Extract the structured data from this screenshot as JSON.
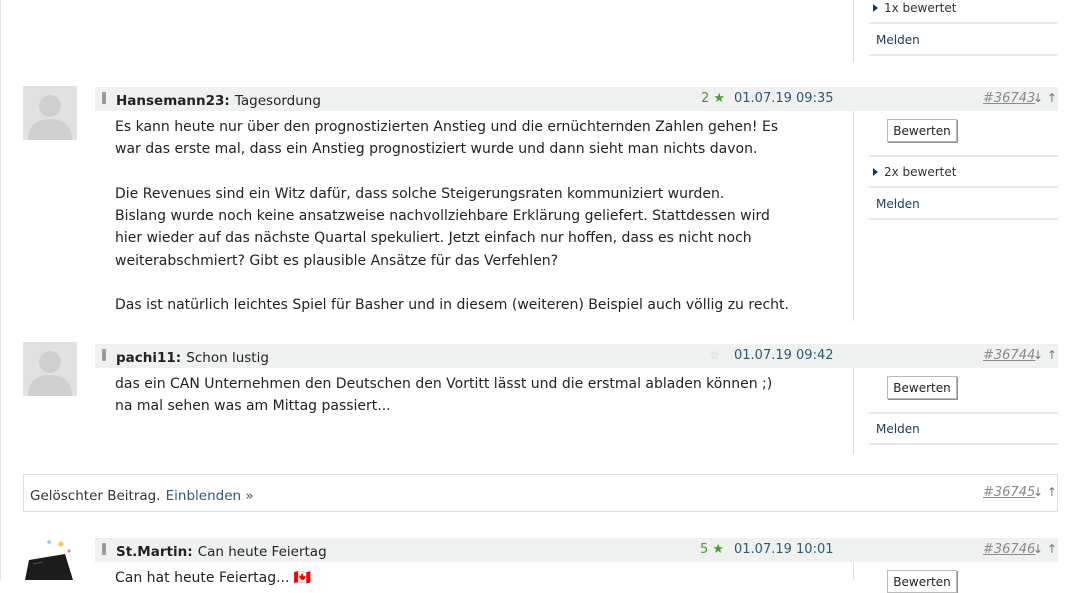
{
  "top_post": {
    "rated_label": "1x bewertet",
    "report_label": "Melden"
  },
  "posts": [
    {
      "author": "Hansemann23:",
      "subject": "Tagesordung",
      "rating_count": "2",
      "rating_star": "★",
      "datetime": "01.07.19 09:35",
      "post_id": "#36743",
      "nav": "↓ ↑",
      "paragraphs": [
        "Es kann heute nur über den prognostizierten Anstieg und die ernüchternden Zahlen gehen! Es war das erste mal, dass ein Anstieg prognostiziert wurde und dann sieht man nichts davon.",
        "Die Revenues sind ein Witz dafür, dass solche Steigerungsraten kommuniziert wurden.\nBislang wurde noch keine ansatzweise nachvollziehbare Erklärung geliefert. Stattdessen wird hier wieder auf das nächste Quartal spekuliert. Jetzt einfach nur hoffen, dass es nicht noch weiterabschmiert? Gibt es plausible Ansätze für das Verfehlen?",
        "Das ist natürlich leichtes Spiel für Basher und in diesem (weiteren) Beispiel auch völlig zu recht."
      ],
      "rate_button": "Bewerten",
      "rated_label": "2x bewertet",
      "report_label": "Melden"
    },
    {
      "author": "pachi11:",
      "subject": "Schon lustig",
      "rating_star": "☆",
      "datetime": "01.07.19 09:42",
      "post_id": "#36744",
      "nav": "↓ ↑",
      "paragraphs": [
        "das ein CAN Unternehmen den Deutschen den Vortitt lässt und die erstmal abladen können ;)\nna mal sehen was am Mittag passiert..."
      ],
      "rate_button": "Bewerten",
      "report_label": "Melden"
    }
  ],
  "deleted_post": {
    "text": "Gelöschter Beitrag.",
    "link": "Einblenden »",
    "post_id": "#36745",
    "nav": "↓ ↑"
  },
  "last_post": {
    "author": "St.Martin:",
    "subject": "Can heute Feiertag",
    "rating_count": "5",
    "rating_star": "★",
    "datetime": "01.07.19 10:01",
    "post_id": "#36746",
    "nav": "↓ ↑",
    "body_first_line": "Can hat heute Feiertag... 🇨🇦",
    "rate_button": "Bewerten"
  }
}
